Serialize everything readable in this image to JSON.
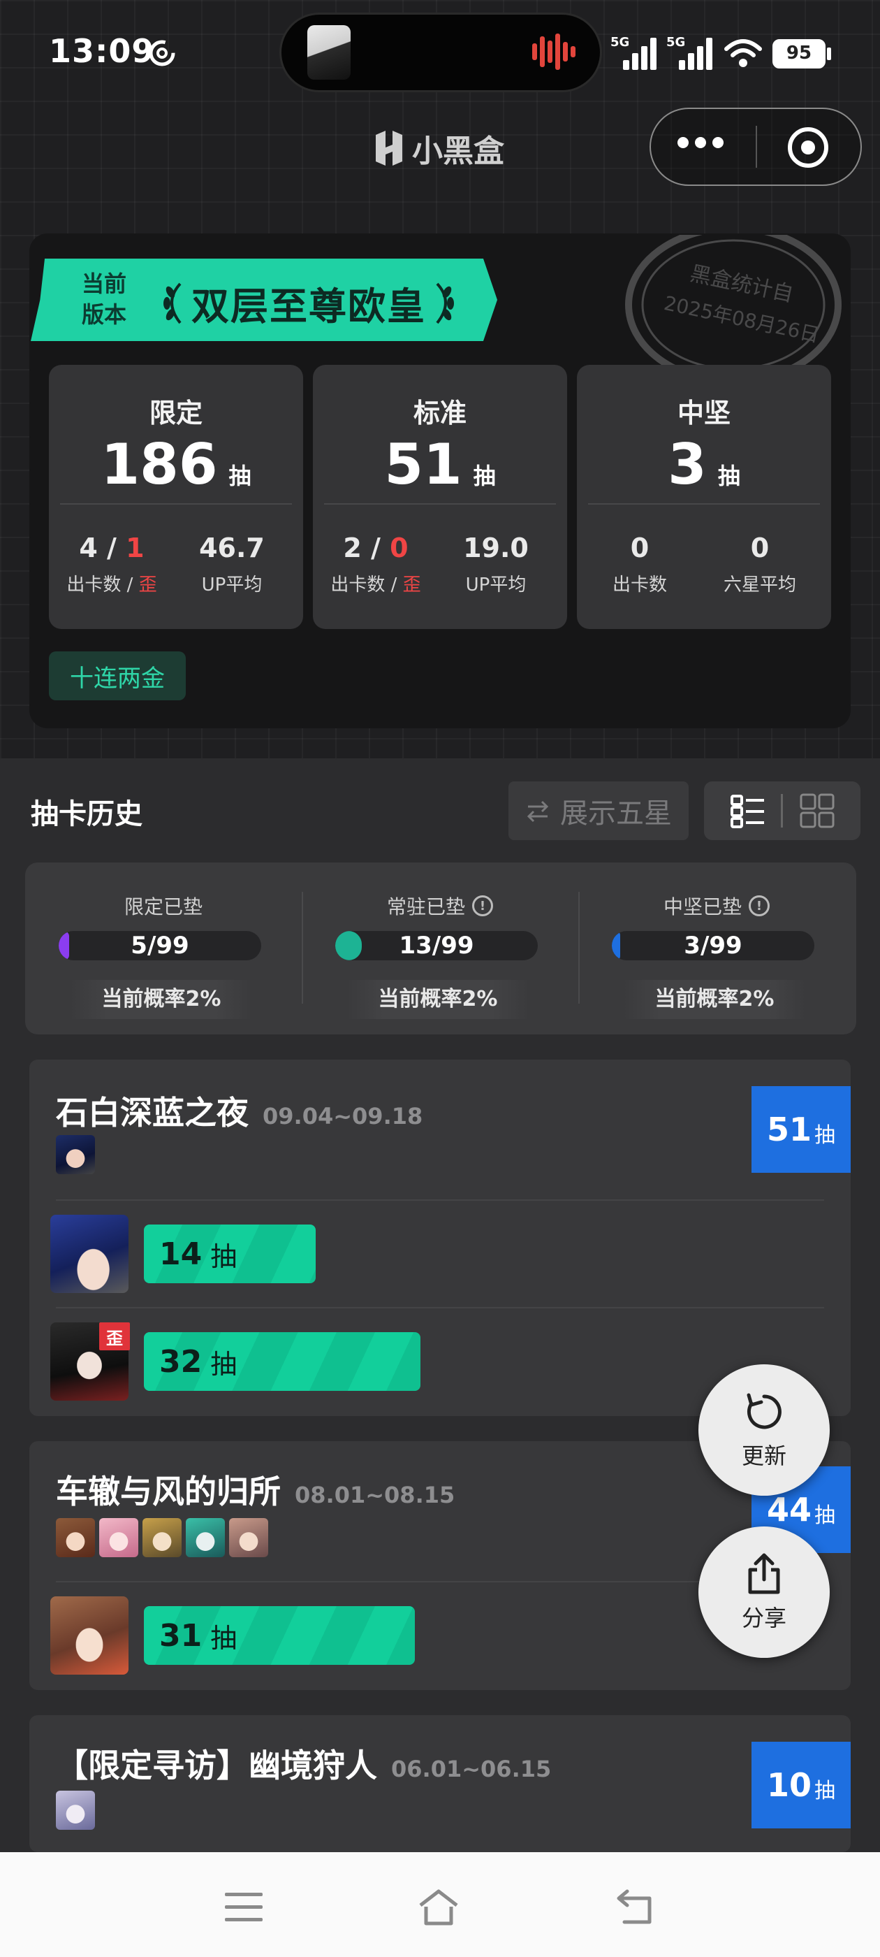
{
  "status_bar": {
    "time": "13:09",
    "network_1": "5G",
    "network_2": "5G",
    "battery": "95"
  },
  "header": {
    "brand_name": "小黑盒"
  },
  "stats_card": {
    "version_label": "当前\n版本",
    "title": "双层至尊欧皇",
    "stamp_text": "黑盒统计自",
    "stamp_date": "2025年08月26日",
    "panels": [
      {
        "title": "限定",
        "count": "186",
        "unit": "抽",
        "left_value_a": "4 / ",
        "left_value_b": "1",
        "left_label_a": "出卡数 / ",
        "left_label_b": "歪",
        "right_value": "46.7",
        "right_label": "UP平均"
      },
      {
        "title": "标准",
        "count": "51",
        "unit": "抽",
        "left_value_a": "2 / ",
        "left_value_b": "0",
        "left_label_a": "出卡数 / ",
        "left_label_b": "歪",
        "right_value": "19.0",
        "right_label": "UP平均"
      },
      {
        "title": "中坚",
        "count": "3",
        "unit": "抽",
        "left_value_a": "0",
        "left_value_b": "",
        "left_label_a": "出卡数",
        "left_label_b": "",
        "right_value": "0",
        "right_label": "六星平均"
      }
    ],
    "tag": "十连两金"
  },
  "history": {
    "title": "抽卡历史",
    "show_five_star": "展示五星"
  },
  "pity": [
    {
      "label": "限定已垫",
      "value": "5/99",
      "fill": 0.05,
      "color": "#8b3df0",
      "info": false,
      "prob": "当前概率2%"
    },
    {
      "label": "常驻已垫",
      "value": "13/99",
      "fill": 0.13,
      "color": "#1db394",
      "info": true,
      "prob": "当前概率2%"
    },
    {
      "label": "中坚已垫",
      "value": "3/99",
      "fill": 0.03,
      "color": "#1e6fe0",
      "info": true,
      "prob": "当前概率2%"
    }
  ],
  "banners": [
    {
      "name": "石白深蓝之夜",
      "dates": "09.04~09.18",
      "count": "51",
      "unit": "抽",
      "pulls": [
        {
          "count": "14",
          "unit": "抽",
          "off_banner": ""
        },
        {
          "count": "32",
          "unit": "抽",
          "off_banner": "歪"
        }
      ]
    },
    {
      "name": "车辙与风的归所",
      "dates": "08.01~08.15",
      "count": "44",
      "unit": "抽",
      "pulls": [
        {
          "count": "31",
          "unit": "抽",
          "off_banner": ""
        }
      ]
    },
    {
      "name": "【限定寻访】幽境狩人",
      "dates": "06.01~06.15",
      "count": "10",
      "unit": "抽",
      "pulls": []
    }
  ],
  "fabs": {
    "refresh": "更新",
    "share": "分享"
  }
}
